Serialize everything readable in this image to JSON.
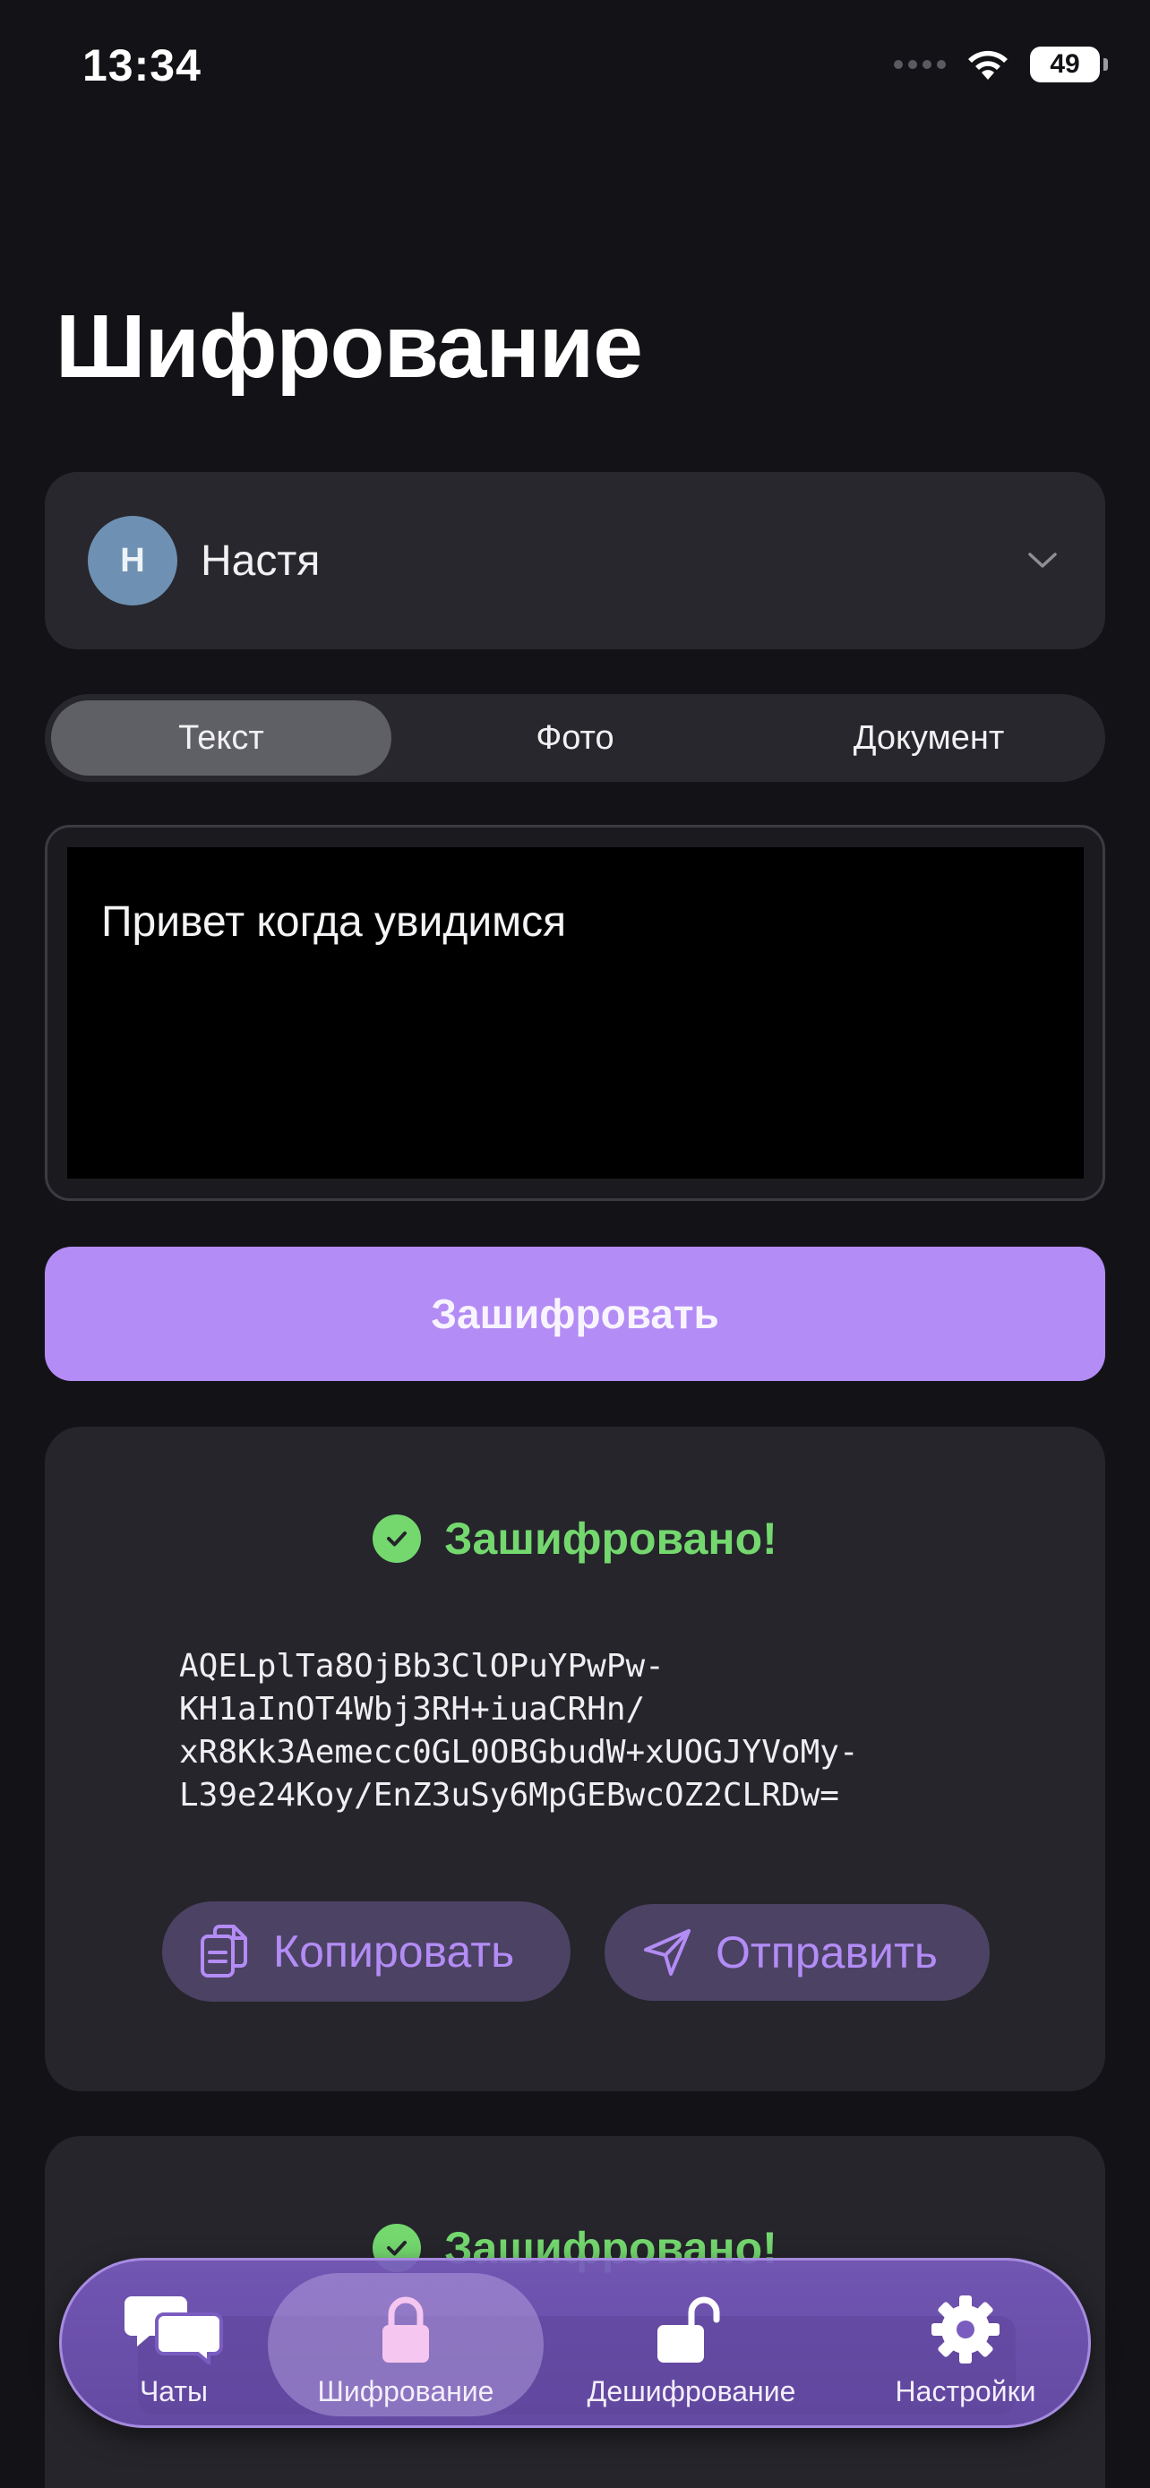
{
  "status_bar": {
    "time": "13:34",
    "battery": "49"
  },
  "page_title": "Шифрование",
  "contact": {
    "initial": "Н",
    "name": "Настя"
  },
  "tabs": [
    {
      "label": "Текст",
      "active": true
    },
    {
      "label": "Фото",
      "active": false
    },
    {
      "label": "Документ",
      "active": false
    }
  ],
  "input": {
    "value": "Привет когда увидимся"
  },
  "encrypt_button": "Зашифровать",
  "result": {
    "status": "Зашифровано!",
    "ciphertext": "AQELplTa8OjBb3ClOPuYPwPw-\nKH1aInOT4Wbj3RH+iuaCRHn/\nxR8Kk3Aemecc0GL0OBGbudW+xUOGJYVoMy-\nL39e24Koy/EnZ3uSy6MpGEBwcOZ2CLRDw=",
    "copy_label": "Копировать",
    "send_label": "Отправить"
  },
  "result_2": {
    "status": "Зашифровано!"
  },
  "nav": [
    {
      "label": "Чаты",
      "icon": "chats-icon",
      "active": false
    },
    {
      "label": "Шифрование",
      "icon": "lock-icon",
      "active": true
    },
    {
      "label": "Дешифрование",
      "icon": "unlock-icon",
      "active": false
    },
    {
      "label": "Настройки",
      "icon": "gear-icon",
      "active": false
    }
  ],
  "colors": {
    "accent": "#b38cf5",
    "success": "#74d86f",
    "background": "#131317",
    "card": "#27272d"
  }
}
